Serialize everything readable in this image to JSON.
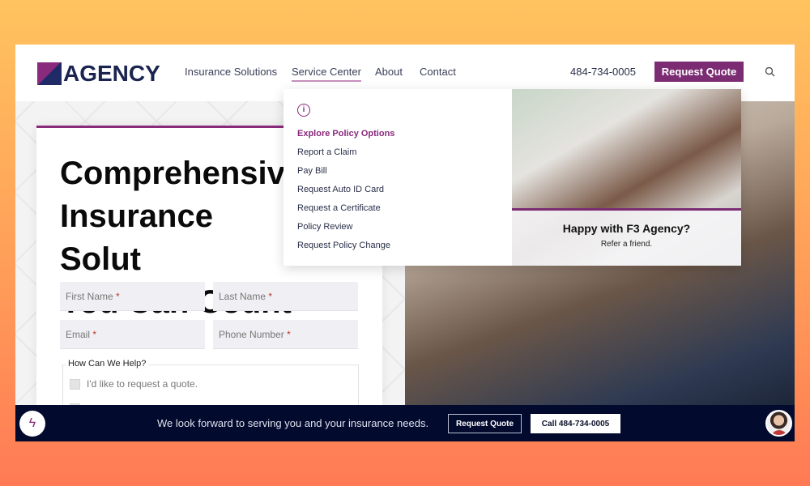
{
  "header": {
    "logo_text": "AGENCY",
    "logo_mark": "F3",
    "nav": [
      "Insurance Solutions",
      "Service Center",
      "About",
      "Contact"
    ],
    "active_nav": "Service Center",
    "phone": "484-734-0005",
    "request_quote": "Request Quote",
    "search_icon": "search-icon"
  },
  "dropdown": {
    "icon": "info-icon",
    "items": [
      "Explore Policy Options",
      "Report a Claim",
      "Pay Bill",
      "Request Auto ID Card",
      "Request a Certificate",
      "Policy Review",
      "Request Policy Change"
    ],
    "promo_title": "Happy with F3 Agency?",
    "promo_sub": "Refer a friend."
  },
  "hero": {
    "heading": "Comprehensive\nInsurance Solut\nYou Can Count"
  },
  "form": {
    "first_name": "First Name",
    "last_name": "Last Name",
    "email": "Email",
    "phone": "Phone Number",
    "required_mark": "*",
    "help_legend": "How Can We Help?",
    "options": [
      "I'd like to request a quote."
    ]
  },
  "bottom_bar": {
    "message": "We look forward to serving you and your insurance needs.",
    "request_quote": "Request Quote",
    "call": "Call 484-734-0005"
  },
  "colors": {
    "brand": "#7b2c73",
    "navy": "#020a2e"
  }
}
